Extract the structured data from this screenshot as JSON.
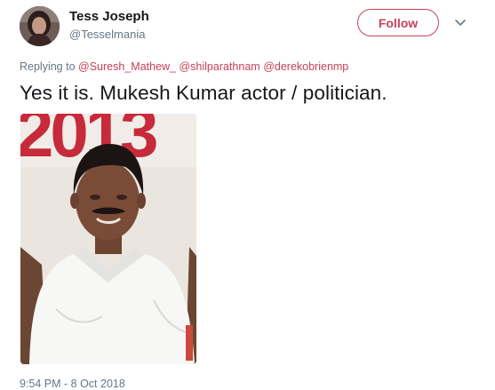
{
  "tweet": {
    "author": {
      "display_name": "Tess Joseph",
      "handle": "@Tesselmania"
    },
    "follow_label": "Follow",
    "menu_icon": "chevron-down-icon",
    "reply": {
      "prefix": "Replying to",
      "mentions": [
        "@Suresh_Mathew_",
        "@shilparathnam",
        "@derekobrienmp"
      ]
    },
    "text": "Yes it is. Mukesh Kumar actor / politician.",
    "media": {
      "banner_text": "2013"
    },
    "timestamp": "9:54 PM - 8 Oct 2018"
  },
  "colors": {
    "accent": "#c8415a",
    "text": "#14171a",
    "muted": "#657786"
  }
}
